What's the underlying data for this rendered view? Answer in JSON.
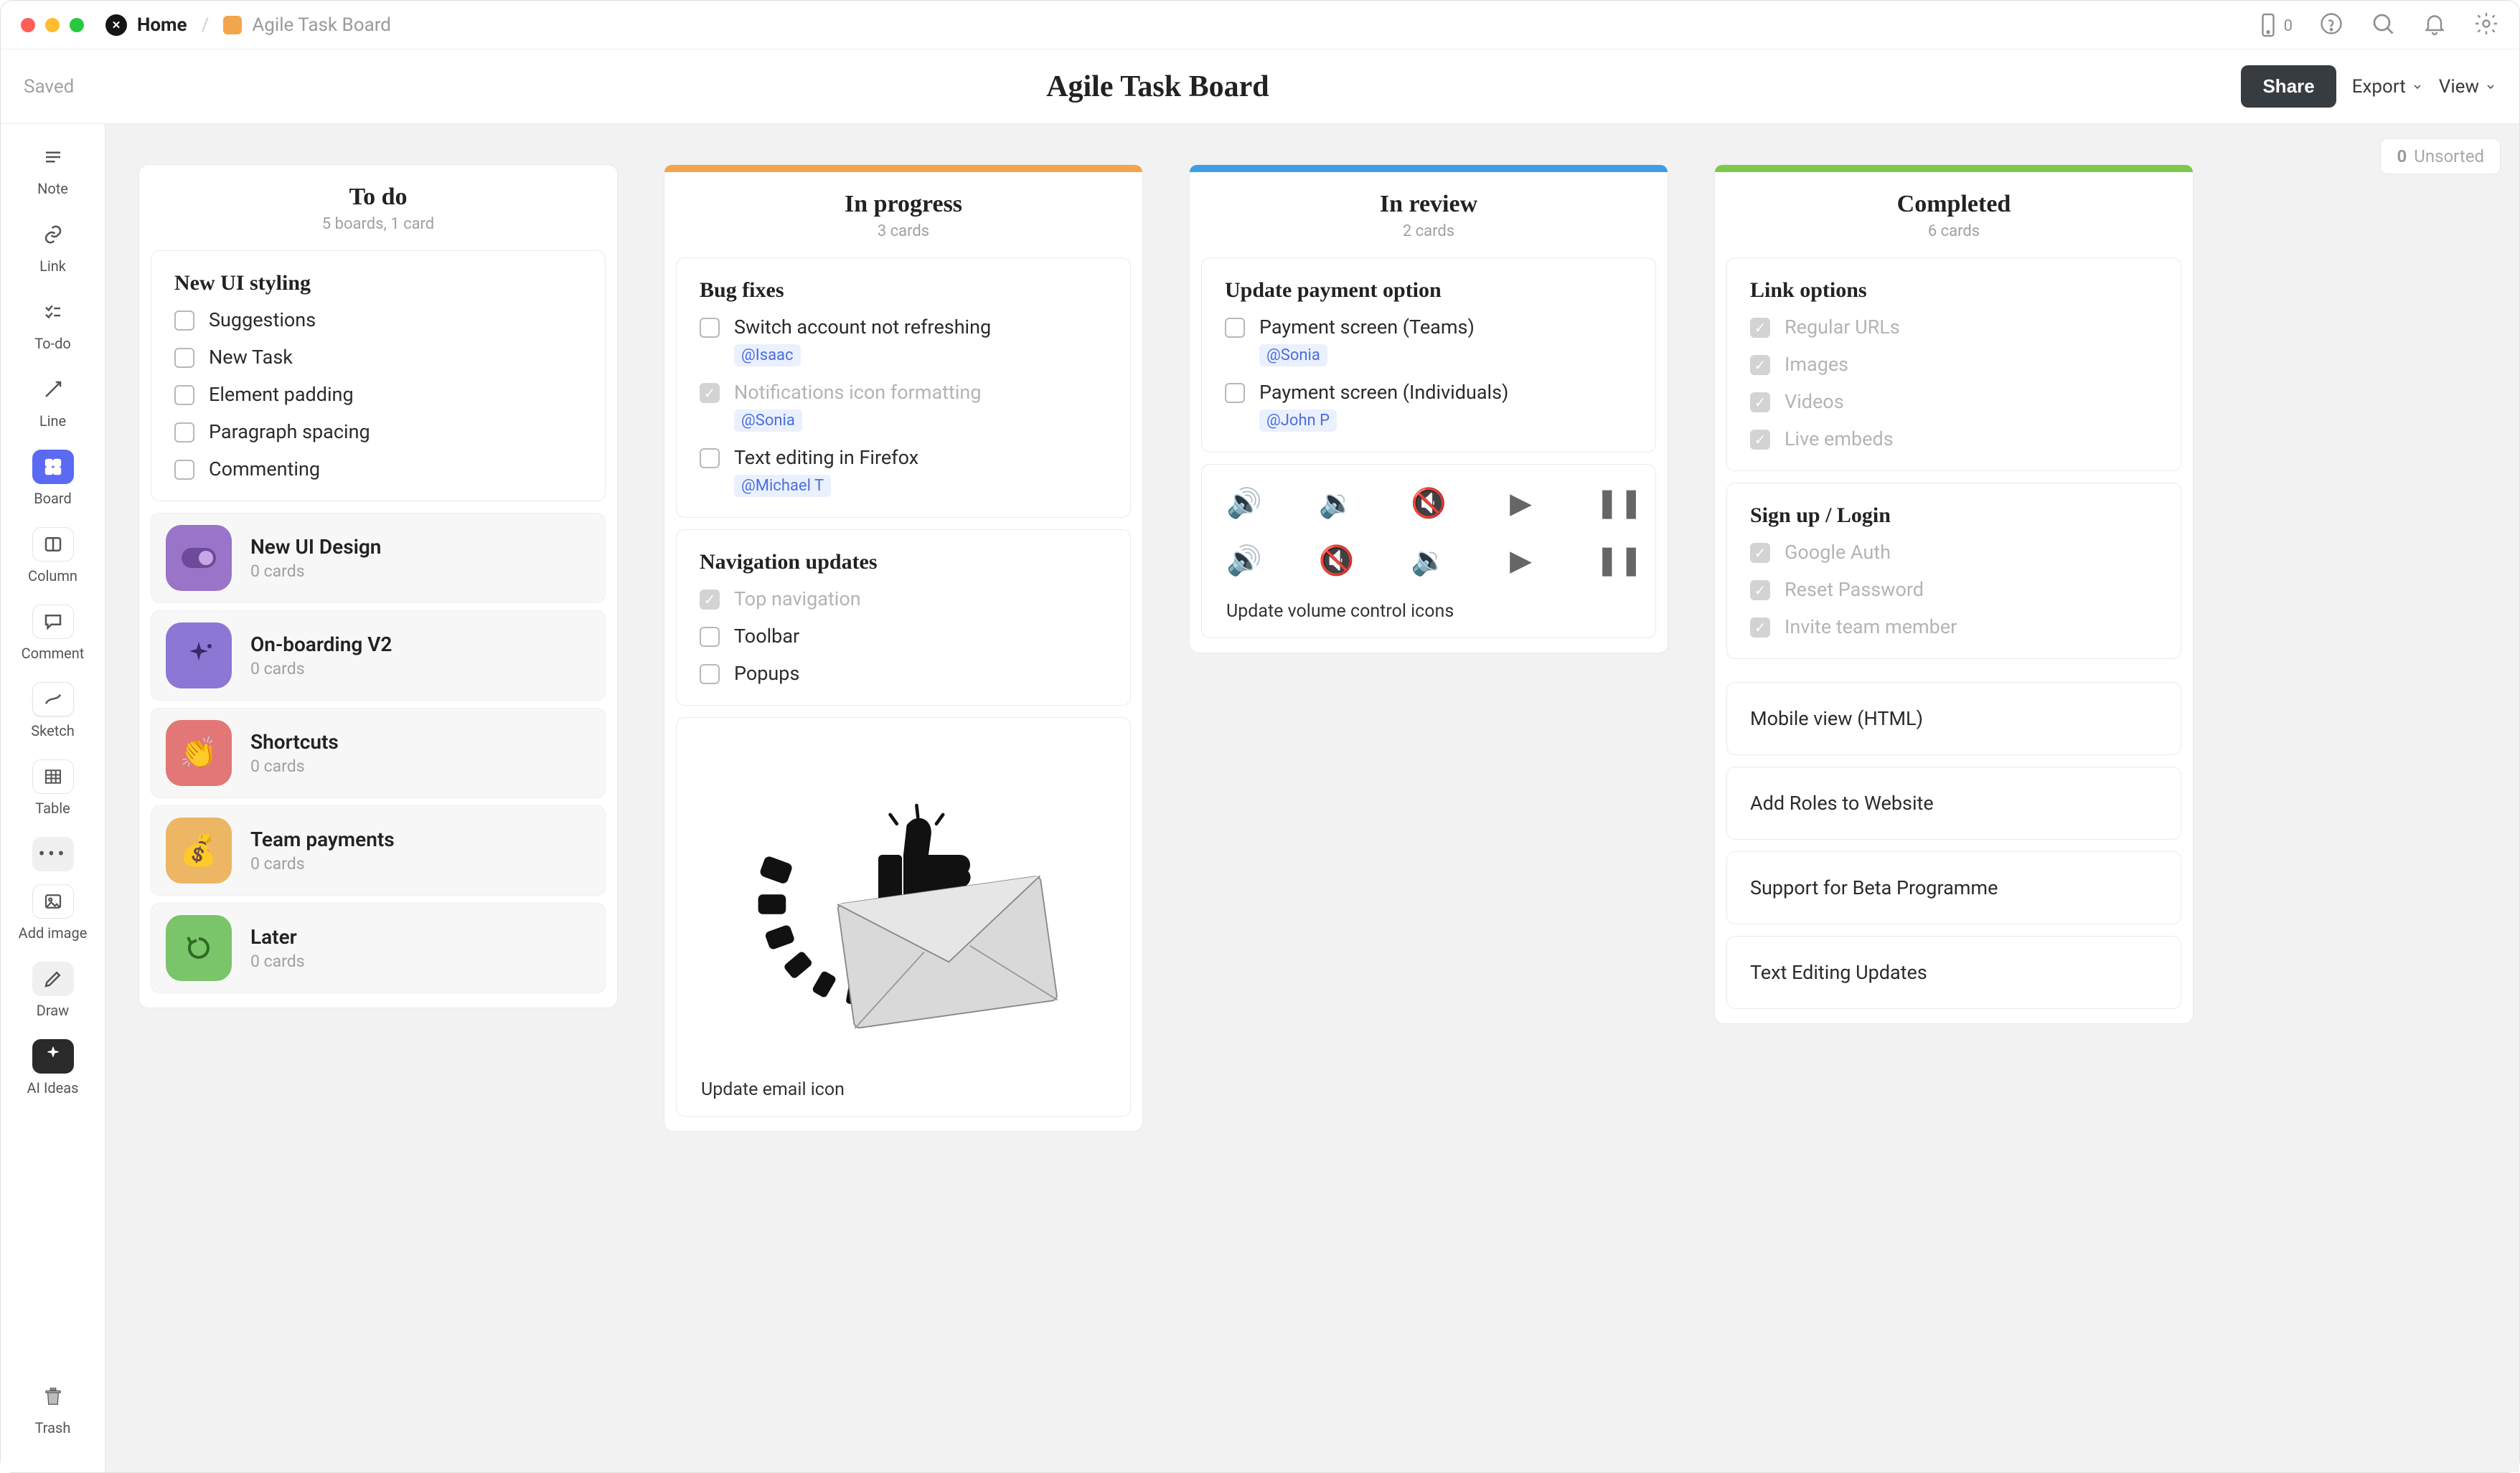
{
  "breadcrumb": {
    "home": "Home",
    "title": "Agile Task Board"
  },
  "osbar": {
    "phone_badge": "0"
  },
  "dochead": {
    "saved": "Saved",
    "title": "Agile Task Board",
    "share": "Share",
    "export": "Export",
    "view": "View"
  },
  "unsorted": {
    "count": "0",
    "label": "Unsorted"
  },
  "rail": [
    {
      "id": "note",
      "label": "Note"
    },
    {
      "id": "link",
      "label": "Link"
    },
    {
      "id": "todo",
      "label": "To-do"
    },
    {
      "id": "line",
      "label": "Line"
    },
    {
      "id": "board",
      "label": "Board",
      "active": true
    },
    {
      "id": "column",
      "label": "Column"
    },
    {
      "id": "comment",
      "label": "Comment"
    },
    {
      "id": "sketch",
      "label": "Sketch"
    },
    {
      "id": "table",
      "label": "Table"
    },
    {
      "id": "more",
      "label": ""
    },
    {
      "id": "addimage",
      "label": "Add image"
    },
    {
      "id": "draw",
      "label": "Draw"
    },
    {
      "id": "aiideas",
      "label": "AI Ideas"
    }
  ],
  "rail_trash": "Trash",
  "columns": {
    "todo": {
      "title": "To do",
      "subtitle": "5 boards, 1 card",
      "card_title": "New UI styling",
      "tasks": [
        "Suggestions",
        "New Task",
        "Element padding",
        "Paragraph spacing",
        "Commenting"
      ],
      "boards": [
        {
          "title": "New UI Design",
          "sub": "0 cards",
          "color": "#9a74c9",
          "emoji": "toggle"
        },
        {
          "title": "On-boarding V2",
          "sub": "0 cards",
          "color": "#8d77d4",
          "emoji": "sparkle"
        },
        {
          "title": "Shortcuts",
          "sub": "0 cards",
          "color": "#e37676",
          "emoji": "hands"
        },
        {
          "title": "Team payments",
          "sub": "0 cards",
          "color": "#edb664",
          "emoji": "moneybag"
        },
        {
          "title": "Later",
          "sub": "0 cards",
          "color": "#7ac46a",
          "emoji": "history"
        }
      ]
    },
    "inprogress": {
      "title": "In progress",
      "subtitle": "3 cards",
      "bugfix_title": "Bug fixes",
      "bugs": [
        {
          "label": "Switch account not refreshing",
          "mention": "@Isaac",
          "done": false
        },
        {
          "label": "Notifications icon formatting",
          "mention": "@Sonia",
          "done": true
        },
        {
          "label": "Text editing in Firefox",
          "mention": "@Michael T",
          "done": false
        }
      ],
      "nav_title": "Navigation updates",
      "nav_tasks": [
        {
          "label": "Top navigation",
          "done": true
        },
        {
          "label": "Toolbar",
          "done": false
        },
        {
          "label": "Popups",
          "done": false
        }
      ],
      "email_caption": "Update email icon"
    },
    "inreview": {
      "title": "In review",
      "subtitle": "2 cards",
      "payment_title": "Update payment option",
      "payment_tasks": [
        {
          "label": "Payment screen (Teams)",
          "mention": "@Sonia"
        },
        {
          "label": "Payment screen (Individuals)",
          "mention": "@John P"
        }
      ],
      "volume_caption": "Update volume control icons"
    },
    "completed": {
      "title": "Completed",
      "subtitle": "6 cards",
      "link_title": "Link options",
      "link_tasks": [
        "Regular URLs",
        "Images",
        "Videos",
        "Live embeds"
      ],
      "auth_title": "Sign up / Login",
      "auth_tasks": [
        "Google Auth",
        "Reset Password",
        "Invite team member"
      ],
      "simple": [
        "Mobile view (HTML)",
        "Add Roles to Website",
        "Support for Beta Programme",
        "Text Editing Updates"
      ]
    }
  }
}
